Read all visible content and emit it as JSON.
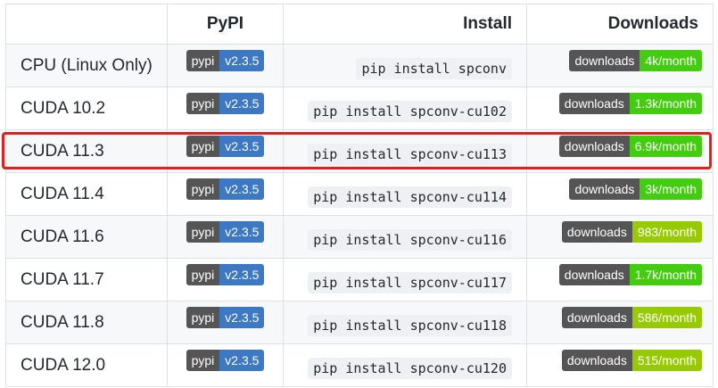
{
  "table": {
    "headers": [
      "",
      "PyPI",
      "Install",
      "Downloads"
    ],
    "rows": [
      {
        "name": "CPU (Linux Only)",
        "pypi_left": "pypi",
        "pypi_right": "v2.3.5",
        "install": "pip install spconv",
        "dl_left": "downloads",
        "dl_right": "4k/month",
        "dl_color": "#4c1"
      },
      {
        "name": "CUDA 10.2",
        "pypi_left": "pypi",
        "pypi_right": "v2.3.5",
        "install": "pip install spconv-cu102",
        "dl_left": "downloads",
        "dl_right": "1.3k/month",
        "dl_color": "#4c1"
      },
      {
        "name": "CUDA 11.3",
        "pypi_left": "pypi",
        "pypi_right": "v2.3.5",
        "install": "pip install spconv-cu113",
        "dl_left": "downloads",
        "dl_right": "6.9k/month",
        "dl_color": "#4c1"
      },
      {
        "name": "CUDA 11.4",
        "pypi_left": "pypi",
        "pypi_right": "v2.3.5",
        "install": "pip install spconv-cu114",
        "dl_left": "downloads",
        "dl_right": "3k/month",
        "dl_color": "#4c1"
      },
      {
        "name": "CUDA 11.6",
        "pypi_left": "pypi",
        "pypi_right": "v2.3.5",
        "install": "pip install spconv-cu116",
        "dl_left": "downloads",
        "dl_right": "983/month",
        "dl_color": "#97ca00"
      },
      {
        "name": "CUDA 11.7",
        "pypi_left": "pypi",
        "pypi_right": "v2.3.5",
        "install": "pip install spconv-cu117",
        "dl_left": "downloads",
        "dl_right": "1.7k/month",
        "dl_color": "#4c1"
      },
      {
        "name": "CUDA 11.8",
        "pypi_left": "pypi",
        "pypi_right": "v2.3.5",
        "install": "pip install spconv-cu118",
        "dl_left": "downloads",
        "dl_right": "586/month",
        "dl_color": "#97ca00"
      },
      {
        "name": "CUDA 12.0",
        "pypi_left": "pypi",
        "pypi_right": "v2.3.5",
        "install": "pip install spconv-cu120",
        "dl_left": "downloads",
        "dl_right": "515/month",
        "dl_color": "#97ca00"
      }
    ]
  },
  "highlight": {
    "color": "#e02020",
    "row": "CUDA 11.3"
  }
}
